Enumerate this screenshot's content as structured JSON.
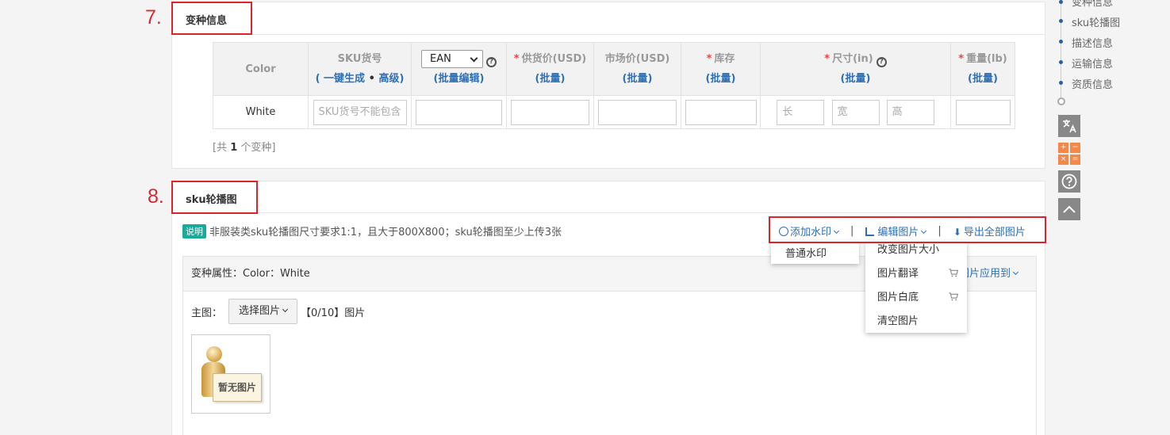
{
  "sections": {
    "variant": {
      "step": "7.",
      "title": "变种信息"
    },
    "sku": {
      "step": "8.",
      "title": "sku轮播图"
    }
  },
  "variant_table": {
    "headers": {
      "color": "Color",
      "sku": "SKU货号",
      "sku_sub_prefix": "( ",
      "sku_gen": "一键生成",
      "sku_dot": " • ",
      "sku_adv": "高级",
      "sku_sub_suffix": ")",
      "ean_select": "EAN",
      "batch_edit": "(批量编辑)",
      "supply_price": "供货价(USD)",
      "market_price": "市场价(USD)",
      "stock": "库存",
      "size": "尺寸(in)",
      "weight": "重量(lb)",
      "batch": "(批量)",
      "required_mark": "*"
    },
    "rows": [
      {
        "color": "White",
        "sku_placeholder": "SKU货号不能包含",
        "size_l": "长",
        "size_w": "宽",
        "size_h": "高"
      }
    ],
    "count_prefix": "[共 ",
    "count": "1",
    "count_suffix": " 个变种]"
  },
  "sku_carousel": {
    "note_tag": "说明",
    "note_text": "非服装类sku轮播图尺寸要求1:1，且大于800X800；sku轮播图至少上传3张",
    "toolbar": {
      "watermark": "添加水印",
      "sep": "|",
      "edit": "编辑图片",
      "export": "导出全部图片"
    },
    "variant_attr_label": "变种属性：Color：White",
    "apply_to": "图片应用到",
    "main_image_label": "主图：",
    "choose_image": "选择图片",
    "image_count": "【0/10】图片",
    "no_image": "暂无图片"
  },
  "watermark_menu": [
    "普通水印"
  ],
  "edit_menu": [
    "改变图片大小",
    "图片翻译",
    "图片白底",
    "清空图片"
  ],
  "right_nav": {
    "items": [
      "变种信息",
      "sku轮播图",
      "描述信息",
      "运输信息",
      "资质信息"
    ]
  },
  "colors": {
    "accent": "#2f6fb4",
    "red_highlight": "#e0222b",
    "tag": "#1aaa9a"
  }
}
